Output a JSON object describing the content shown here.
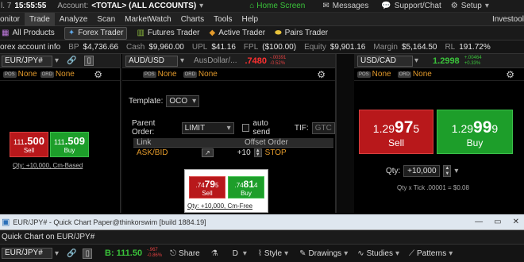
{
  "topbar": {
    "left_frag": "l. 7",
    "time": "15:55:55",
    "account_label": "Account:",
    "account_value": "<TOTAL> (ALL ACCOUNTS)",
    "home": "Home Screen",
    "messages": "Messages",
    "support": "Support/Chat",
    "setup": "Setup"
  },
  "menu": {
    "items": [
      "onitor",
      "Trade",
      "Analyze",
      "Scan",
      "MarketWatch",
      "Charts",
      "Tools",
      "Help"
    ],
    "right": "Investool"
  },
  "toolbar": {
    "items": [
      "All Products",
      "Forex Trader",
      "Futures Trader",
      "Active Trader",
      "Pairs Trader"
    ]
  },
  "account_bar": {
    "info": "orex account info",
    "fields": [
      {
        "label": "BP",
        "value": "$4,736.66"
      },
      {
        "label": "Cash",
        "value": "$9,960.00"
      },
      {
        "label": "UPL",
        "value": "$41.16"
      },
      {
        "label": "FPL",
        "value": "($100.00)"
      },
      {
        "label": "Equity",
        "value": "$9,901.16"
      },
      {
        "label": "Margin",
        "value": "$5,164.50"
      },
      {
        "label": "RL",
        "value": "191.72%"
      }
    ]
  },
  "panel1": {
    "symbol": "EUR/JPY#",
    "pos_tag": "POS",
    "pos_val": "None",
    "ord_tag": "ORD",
    "ord_val": "None",
    "sell_small": "111",
    "sell_big": ".500",
    "sell_label": "Sell",
    "buy_small": "111",
    "buy_big": ".509",
    "buy_label": "Buy",
    "qty_link": "Qty: +10,000, Cm-Based"
  },
  "panel2": {
    "symbol": "AUD/USD",
    "alt_symbol": "AusDollar/...",
    "price": ".7480",
    "change1": "-.00391",
    "change2": "-0.52%",
    "pos_tag": "POS",
    "pos_val": "None",
    "ord_tag": "ORD",
    "ord_val": "None",
    "template_label": "Template:",
    "template_value": "OCO",
    "parent_order_label": "Parent Order:",
    "parent_order_value": "LIMIT",
    "auto_send": "auto send",
    "tif_label": "TIF:",
    "tif_value": "GTC",
    "col_link": "Link",
    "col_offset": "Offset Order",
    "link_value": "ASK/BID",
    "offset_value": "+10",
    "stop_value": "STOP",
    "sell_small": ".74",
    "sell_big": "79",
    "sell_tail": "5",
    "sell_label": "Sell",
    "buy_small": ".74",
    "buy_big": "81",
    "buy_tail": "4",
    "buy_label": "Buy",
    "qty_link": "Qty: +10,000, Cm-Free"
  },
  "panel3": {
    "symbol": "USD/CAD",
    "price": "1.2998",
    "change1": "+.00464",
    "change2": "+0.33%",
    "pos_tag": "POS",
    "pos_val": "None",
    "ord_tag": "ORD",
    "ord_val": "None",
    "sell_small": "1.29",
    "sell_big": "97",
    "sell_tail": "5",
    "sell_label": "Sell",
    "buy_small": "1.29",
    "buy_big": "99",
    "buy_tail": "9",
    "buy_label": "Buy",
    "qty_label": "Qty:",
    "qty_value": "+10,000",
    "tick_text": "Qty x Tick .00001 = $0.08"
  },
  "taskbar": {
    "title": "EUR/JPY# - Quick Chart Paper@thinkorswim [build 1884.19]"
  },
  "quickchart": {
    "title": "Quick Chart on EUR/JPY#",
    "symbol": "EUR/JPY#",
    "bid": "B: 111.50",
    "change1": "-.967",
    "change2": "-0.86%",
    "share": "Share",
    "interval": "D",
    "style": "Style",
    "drawings": "Drawings",
    "studies": "Studies",
    "patterns": "Patterns"
  },
  "colors": {
    "sell": "#b8181b",
    "buy": "#1d9e2a",
    "accent_orange": "#e39a2b",
    "home_green": "#3ac33a"
  }
}
